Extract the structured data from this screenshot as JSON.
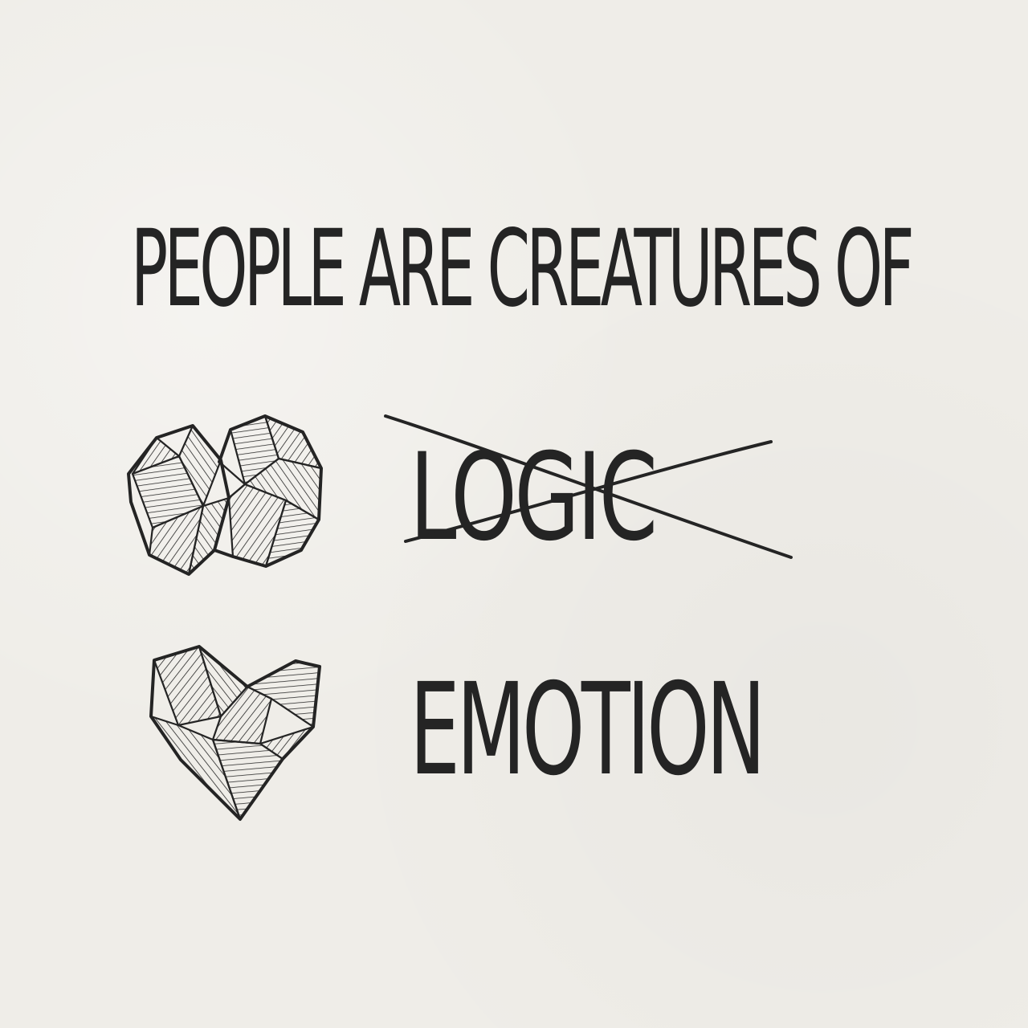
{
  "headline": "PEOPLE ARE CREATURES OF",
  "options": [
    {
      "label": "LOGIC",
      "crossed_out": true,
      "icon": "brain-icon"
    },
    {
      "label": "EMOTION",
      "crossed_out": false,
      "icon": "heart-icon"
    }
  ],
  "colors": {
    "paper": "#efede8",
    "ink": "#242424"
  }
}
